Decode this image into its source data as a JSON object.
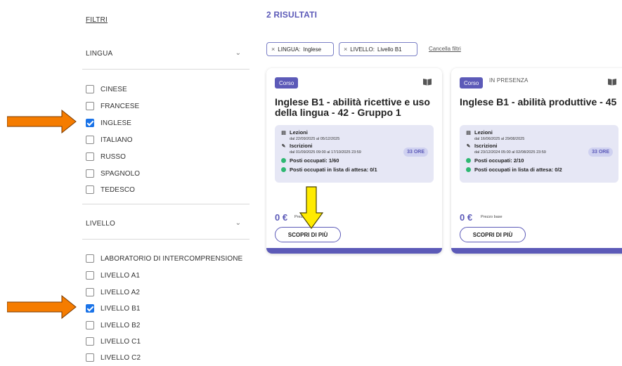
{
  "sidebar": {
    "filters_title": "FILTRI",
    "sections": [
      {
        "label": "LINGUA",
        "chevron": "chevron-down-icon",
        "options": [
          {
            "label": "CINESE",
            "checked": false
          },
          {
            "label": "FRANCESE",
            "checked": false
          },
          {
            "label": "INGLESE",
            "checked": true
          },
          {
            "label": "ITALIANO",
            "checked": false
          },
          {
            "label": "RUSSO",
            "checked": false
          },
          {
            "label": "SPAGNOLO",
            "checked": false
          },
          {
            "label": "TEDESCO",
            "checked": false
          }
        ]
      },
      {
        "label": "LIVELLO",
        "chevron": "chevron-down-icon",
        "options": [
          {
            "label": "LABORATORIO DI INTERCOMPRENSIONE",
            "checked": false
          },
          {
            "label": "LIVELLO A1",
            "checked": false
          },
          {
            "label": "LIVELLO A2",
            "checked": false
          },
          {
            "label": "LIVELLO B1",
            "checked": true
          },
          {
            "label": "LIVELLO B2",
            "checked": false
          },
          {
            "label": "LIVELLO C1",
            "checked": false
          },
          {
            "label": "LIVELLO C2",
            "checked": false
          }
        ]
      }
    ]
  },
  "main": {
    "results_title": "2 RISULTATI",
    "chips": [
      {
        "remove": "×",
        "key": "LINGUA:",
        "value": "Inglese"
      },
      {
        "remove": "×",
        "key": "LIVELLO:",
        "value": "Livello B1"
      }
    ],
    "clear_filters": "Cancella filtri",
    "cards": [
      {
        "badge": "Corso",
        "mode": "",
        "title_line1": "Inglese B1 - abilità ricettive e uso",
        "title_line2": "della lingua - 42 - Gruppo 1",
        "lessons_label": "Lezioni",
        "lessons_dates": "dal 22/09/2025 al 05/12/2025",
        "enrol_label": "Iscrizioni",
        "enrol_dates": "dal 01/09/2025 09:00 al 17/10/2025 23:59",
        "hours": "33 ORE",
        "seats": "Posti occupati: 1/60",
        "waitlist": "Posti occupati in lista di attesa: 0/1",
        "price": "0 €",
        "price_label": "Prezzo base",
        "button": "SCOPRI DI PIÙ"
      },
      {
        "badge": "Corso",
        "mode": "IN PRESENZA",
        "title_line1": "Inglese B1 - abilità produttive - 45",
        "title_line2": "",
        "lessons_label": "Lezioni",
        "lessons_dates": "dal 16/06/2025 al 29/08/2025",
        "enrol_label": "Iscrizioni",
        "enrol_dates": "dal 23/12/2024 05:00 al 02/08/2025 23:59",
        "hours": "33 ORE",
        "seats": "Posti occupati: 2/10",
        "waitlist": "Posti occupati in lista di attesa: 0/2",
        "price": "0 €",
        "price_label": "Prezzo base",
        "button": "SCOPRI DI PIÙ"
      }
    ]
  },
  "annotations": {
    "side_arrow_color": "#f57c00",
    "down_arrow_color": "#ffeb00"
  }
}
